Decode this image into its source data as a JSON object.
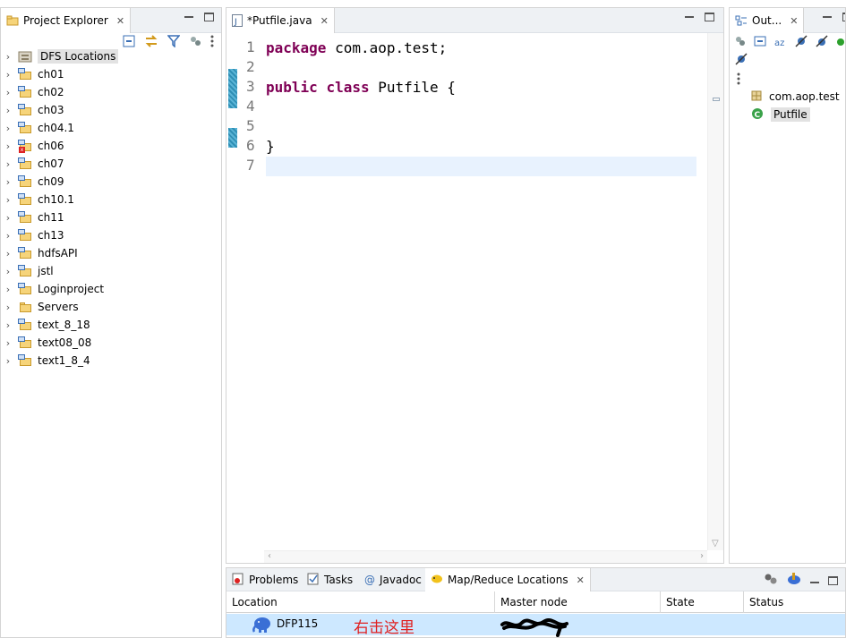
{
  "explorer": {
    "tab_label": "Project Explorer",
    "items": [
      {
        "label": "DFS Locations",
        "kind": "dfs",
        "selected": true
      },
      {
        "label": "ch01",
        "kind": "project"
      },
      {
        "label": "ch02",
        "kind": "project"
      },
      {
        "label": "ch03",
        "kind": "project"
      },
      {
        "label": "ch04.1",
        "kind": "project"
      },
      {
        "label": "ch06",
        "kind": "project-error"
      },
      {
        "label": "ch07",
        "kind": "project"
      },
      {
        "label": "ch09",
        "kind": "project"
      },
      {
        "label": "ch10.1",
        "kind": "project"
      },
      {
        "label": "ch11",
        "kind": "project"
      },
      {
        "label": "ch13",
        "kind": "project"
      },
      {
        "label": "hdfsAPI",
        "kind": "project"
      },
      {
        "label": "jstl",
        "kind": "project"
      },
      {
        "label": "Loginproject",
        "kind": "project"
      },
      {
        "label": "Servers",
        "kind": "folder"
      },
      {
        "label": "text_8_18",
        "kind": "project"
      },
      {
        "label": "text08_08",
        "kind": "project"
      },
      {
        "label": "text1_8_4",
        "kind": "project"
      }
    ]
  },
  "editor": {
    "tab_label": "*Putfile.java",
    "lines": [
      {
        "num": "1",
        "parts": [
          {
            "kw": "package"
          },
          {
            "t": " com.aop.test;"
          }
        ]
      },
      {
        "num": "2",
        "parts": []
      },
      {
        "num": "3",
        "parts": [
          {
            "kw": "public"
          },
          {
            "t": " "
          },
          {
            "kw": "class"
          },
          {
            "t": " Putfile {"
          }
        ]
      },
      {
        "num": "4",
        "parts": []
      },
      {
        "num": "5",
        "parts": []
      },
      {
        "num": "6",
        "parts": [
          {
            "t": "}"
          }
        ]
      },
      {
        "num": "7",
        "parts": []
      }
    ]
  },
  "outline": {
    "tab_label": "Out...",
    "items": [
      {
        "label": "com.aop.test",
        "icon": "package-icon"
      },
      {
        "label": "Putfile",
        "icon": "class-icon",
        "selected": true
      }
    ]
  },
  "bottom": {
    "tabs": [
      "Problems",
      "Tasks",
      "Javadoc",
      "Map/Reduce Locations"
    ],
    "columns": [
      "Location",
      "Master node",
      "State",
      "Status"
    ],
    "row": {
      "location": "DFP115",
      "annotation": "右击这里"
    }
  },
  "colors": {
    "keyword": "#7f0055",
    "annotation": "#e02020",
    "selection": "#cde8ff"
  }
}
